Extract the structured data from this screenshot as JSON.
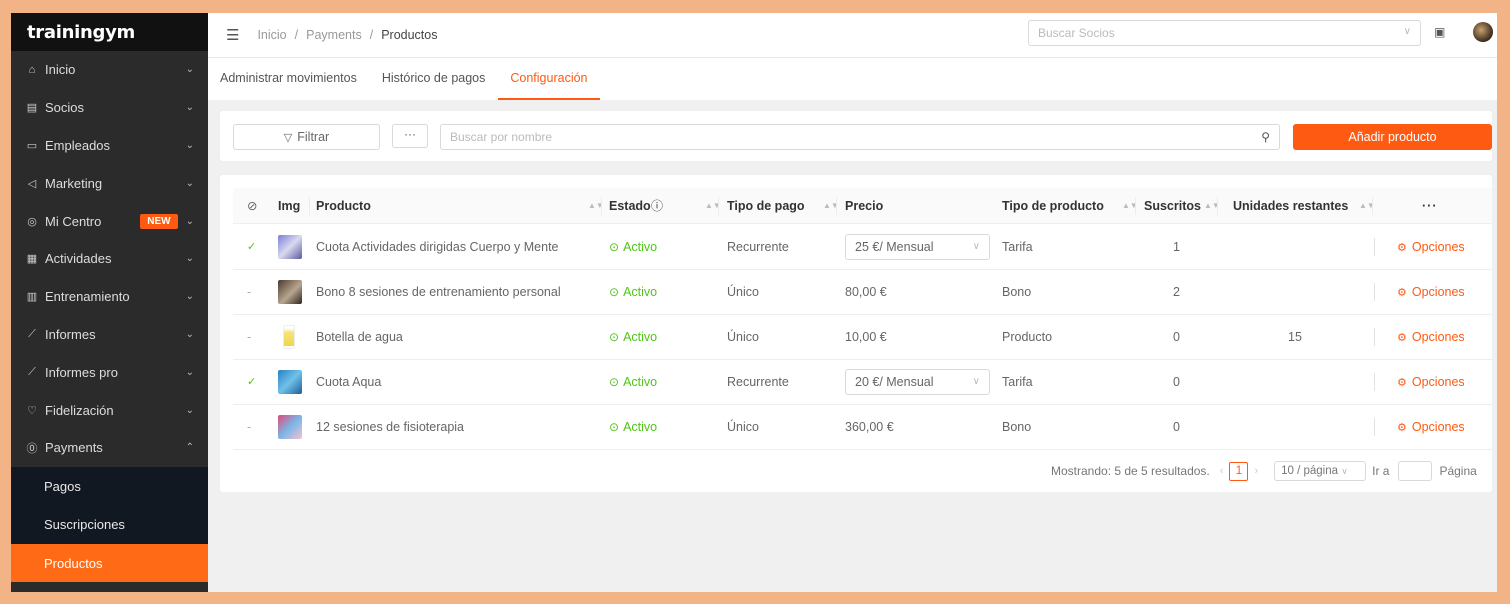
{
  "brand": {
    "logo_text": "trainingym",
    "accent_color": "#ff5a12"
  },
  "sidebar": {
    "items": [
      {
        "label": "Inicio",
        "icon": "home-icon"
      },
      {
        "label": "Socios",
        "icon": "id-card-icon"
      },
      {
        "label": "Empleados",
        "icon": "id-badge-icon"
      },
      {
        "label": "Marketing",
        "icon": "megaphone-icon"
      },
      {
        "label": "Mi Centro",
        "icon": "location-pin-icon",
        "badge": "NEW"
      },
      {
        "label": "Actividades",
        "icon": "calendar-icon"
      },
      {
        "label": "Entrenamiento",
        "icon": "clipboard-icon"
      },
      {
        "label": "Informes",
        "icon": "chart-line-icon"
      },
      {
        "label": "Informes pro",
        "icon": "chart-line-icon"
      },
      {
        "label": "Fidelización",
        "icon": "heart-icon"
      },
      {
        "label": "Payments",
        "icon": "coin-icon",
        "expanded": true
      }
    ],
    "subitems": [
      {
        "label": "Pagos"
      },
      {
        "label": "Suscripciones"
      },
      {
        "label": "Productos",
        "active": true
      }
    ]
  },
  "topbar": {
    "breadcrumb": [
      "Inicio",
      "Payments",
      "Productos"
    ],
    "separator": "/",
    "search_placeholder": "Buscar Socios"
  },
  "tabs": [
    {
      "label": "Administrar movimientos"
    },
    {
      "label": "Histórico de pagos"
    },
    {
      "label": "Configuración",
      "active": true
    }
  ],
  "toolbar": {
    "filter_label": "Filtrar",
    "more_label": "···",
    "search_placeholder": "Buscar por nombre",
    "add_label": "Añadir producto"
  },
  "table": {
    "headers": {
      "img": "Img",
      "producto": "Producto",
      "estado": "Estado",
      "tipo_pago": "Tipo de pago",
      "precio": "Precio",
      "tipo_producto": "Tipo de producto",
      "suscritos": "Suscritos",
      "unidades": "Unidades restantes",
      "more": "···"
    },
    "rows": [
      {
        "linked": "✓",
        "producto": "Cuota Actividades dirigidas Cuerpo y Mente",
        "estado": "Activo",
        "tipo_pago": "Recurrente",
        "precio": "25 €/ Mensual",
        "precio_select": true,
        "tipo_producto": "Tarifa",
        "suscritos": "1",
        "unidades": "",
        "opciones": "Opciones"
      },
      {
        "linked": "-",
        "producto": "Bono 8 sesiones de entrenamiento personal",
        "estado": "Activo",
        "tipo_pago": "Único",
        "precio": "80,00 €",
        "precio_select": false,
        "tipo_producto": "Bono",
        "suscritos": "2",
        "unidades": "",
        "opciones": "Opciones"
      },
      {
        "linked": "-",
        "producto": "Botella de agua",
        "estado": "Activo",
        "tipo_pago": "Único",
        "precio": "10,00 €",
        "precio_select": false,
        "tipo_producto": "Producto",
        "suscritos": "0",
        "unidades": "15",
        "opciones": "Opciones"
      },
      {
        "linked": "✓",
        "producto": "Cuota Aqua",
        "estado": "Activo",
        "tipo_pago": "Recurrente",
        "precio": "20 €/ Mensual",
        "precio_select": true,
        "tipo_producto": "Tarifa",
        "suscritos": "0",
        "unidades": "",
        "opciones": "Opciones"
      },
      {
        "linked": "-",
        "producto": "12 sesiones de fisioterapia",
        "estado": "Activo",
        "tipo_pago": "Único",
        "precio": "360,00 €",
        "precio_select": false,
        "tipo_producto": "Bono",
        "suscritos": "0",
        "unidades": "",
        "opciones": "Opciones"
      }
    ]
  },
  "pagination": {
    "summary": "Mostrando: 5 de 5 resultados.",
    "current_page": "1",
    "page_size": "10 / página",
    "goto_label": "Ir a",
    "page_label": "Página"
  }
}
